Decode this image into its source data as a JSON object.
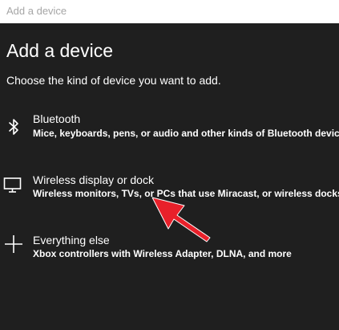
{
  "window": {
    "title": "Add a device"
  },
  "main": {
    "heading": "Add a device",
    "subheading": "Choose the kind of device you want to add."
  },
  "options": [
    {
      "icon": "bluetooth-icon",
      "title": "Bluetooth",
      "description": "Mice, keyboards, pens, or audio and other kinds of Bluetooth devices"
    },
    {
      "icon": "monitor-icon",
      "title": "Wireless display or dock",
      "description": "Wireless monitors, TVs, or PCs that use Miracast, or wireless docks"
    },
    {
      "icon": "plus-icon",
      "title": "Everything else",
      "description": "Xbox controllers with Wireless Adapter, DLNA, and more"
    }
  ],
  "colors": {
    "background": "#1f1f1f",
    "titlebar": "#ffffff",
    "titlebar_text": "#a6a6a6",
    "text": "#ffffff",
    "annotation_arrow": "#e8202a"
  }
}
